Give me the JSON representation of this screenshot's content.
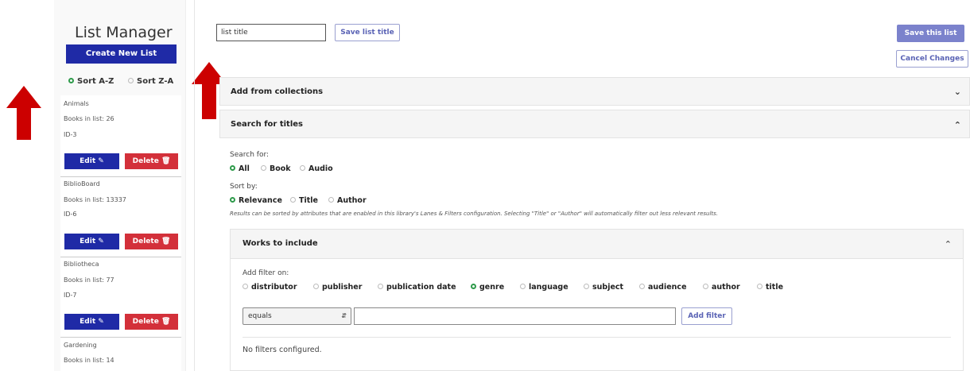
{
  "sidebar": {
    "title": "List Manager",
    "create_button": "Create New List",
    "sort_az": "Sort A-Z",
    "sort_za": "Sort Z-A",
    "lists": [
      {
        "name": "Animals",
        "books": "Books in list: 26",
        "id": "ID-3",
        "edit": "Edit",
        "delete": "Delete"
      },
      {
        "name": "BiblioBoard",
        "books": "Books in list: 13337",
        "id": "ID-6",
        "edit": "Edit",
        "delete": "Delete"
      },
      {
        "name": "Bibliotheca",
        "books": "Books in list: 77",
        "id": "ID-7",
        "edit": "Edit",
        "delete": "Delete"
      },
      {
        "name": "Gardening",
        "books": "Books in list: 14"
      }
    ]
  },
  "header": {
    "title_value": "list title",
    "save_title_button": "Save list title",
    "save_list_button": "Save this list",
    "cancel_button": "Cancel Changes"
  },
  "panels": {
    "collections": "Add from collections",
    "search": "Search for titles"
  },
  "search": {
    "search_for_label": "Search for:",
    "search_for_options": [
      "All",
      "Book",
      "Audio"
    ],
    "sort_by_label": "Sort by:",
    "sort_by_options": [
      "Relevance",
      "Title",
      "Author"
    ],
    "note": "Results can be sorted by attributes that are enabled in this library's Lanes & Filters configuration. Selecting \"Title\" or \"Author\" will automatically filter out less relevant results."
  },
  "works": {
    "title": "Works to include",
    "add_filter_label": "Add filter on:",
    "filter_options": [
      "distributor",
      "publisher",
      "publication date",
      "genre",
      "language",
      "subject",
      "audience",
      "author",
      "title"
    ],
    "selected_filter": "genre",
    "operator": "equals",
    "add_filter_button": "Add filter",
    "empty_text": "No filters configured."
  },
  "colors": {
    "primary": "#1f2aa6",
    "danger": "#d3303a",
    "selected_radio": "#2e9a4a",
    "annotation_arrow": "#cc0000"
  }
}
